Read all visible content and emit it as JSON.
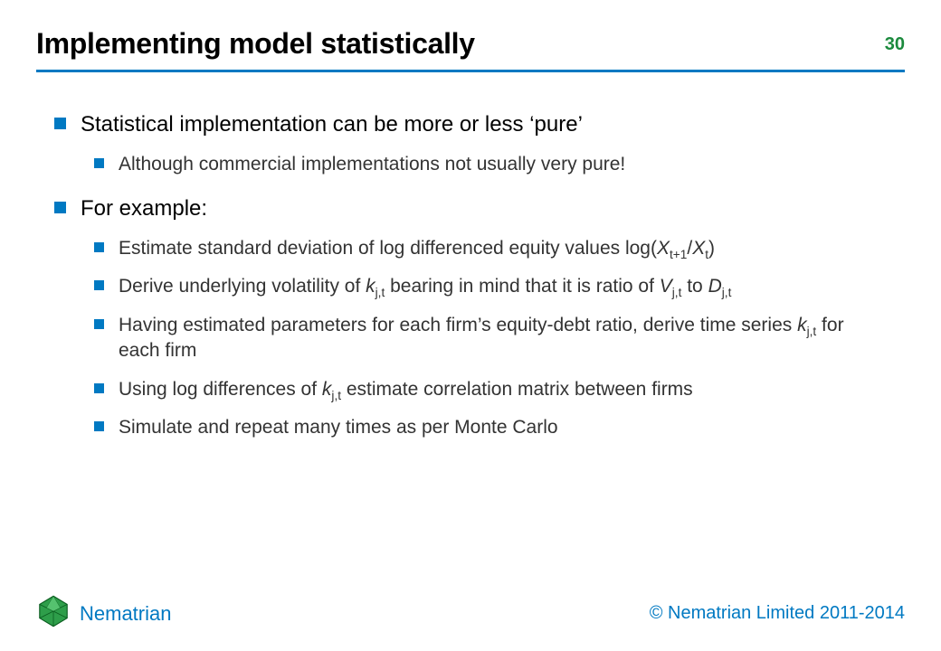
{
  "header": {
    "title": "Implementing model statistically",
    "page_number": "30"
  },
  "bullets": {
    "b1": "Statistical implementation can be more or less ‘pure’",
    "b1a": "Although commercial implementations not usually very pure!",
    "b2": "For example:",
    "b2a_pre": "Estimate standard deviation of log differenced equity values log(",
    "b2a_X": "X",
    "b2a_sub1": "t+1",
    "b2a_slash": "/",
    "b2a_sub2": "t",
    "b2a_post": ")",
    "b2b_pre": "Derive underlying volatility of ",
    "b2b_k": "k",
    "b2b_ksub": "j,t",
    "b2b_mid": " bearing in mind that it is ratio of ",
    "b2b_V": "V",
    "b2b_Vsub": "j,t",
    "b2b_to": " to ",
    "b2b_D": "D",
    "b2b_Dsub": "j,t",
    "b2c_pre": "Having estimated parameters for each firm’s equity-debt ratio, derive time series ",
    "b2c_k": "k",
    "b2c_ksub": "j,t",
    "b2c_post": " for each firm",
    "b2d_pre": "Using log differences of ",
    "b2d_k": "k",
    "b2d_ksub": "j,t",
    "b2d_post": " estimate correlation matrix between firms",
    "b2e": "Simulate and repeat many times as per Monte Carlo"
  },
  "footer": {
    "brand": "Nematrian",
    "copyright": "© Nematrian Limited 2011-2014"
  },
  "icons": {
    "logo": "nematrian-logo"
  }
}
